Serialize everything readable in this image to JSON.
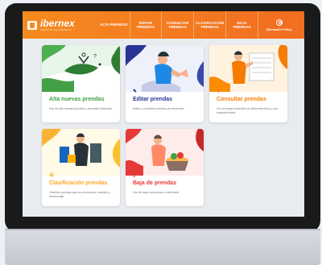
{
  "app": {
    "logo_name": "ibernex",
    "logo_tagline": "GESTIÓN DE PRENDAS"
  },
  "nav": [
    {
      "label": "ALTA PRENDAS"
    },
    {
      "label": "EDITAR PRENDAS"
    },
    {
      "label": "CONSULTAR PRENDAS"
    },
    {
      "label": "CLASIFICACIÓN PRENDAS"
    },
    {
      "label": "BAJA PRENDAS"
    }
  ],
  "user": {
    "name": "(Bernardo Peña)"
  },
  "cards": [
    {
      "title": "Alta nuevas prendas",
      "icon": "plus-icon",
      "glyph": "+",
      "description": "Dar de alta nuevas prendas y asociarle etiquetas.",
      "color": "#43a047"
    },
    {
      "title": "Editar prendas",
      "icon": "pencil-icon",
      "glyph": "✎",
      "description": "Editar y modificar prendas ya existentes.",
      "color": "#283593"
    },
    {
      "title": "Consultar prendas",
      "icon": "magnifier-icon",
      "glyph": "⚲",
      "description": "Ver prendas existentes de diferentes tipos y sus características.",
      "color": "#f57c00"
    },
    {
      "title": "Clasificación prendas",
      "icon": "hierarchy-icon",
      "glyph": "⁂",
      "description": "Clasifica prendas para su procesado, traslado y almacenaje.",
      "color": "#f9b233"
    },
    {
      "title": "Baja de prendas",
      "icon": "trash-icon",
      "glyph": "▯",
      "description": "Dar de baja una prenda o eliminarla.",
      "color": "#e53935"
    }
  ]
}
